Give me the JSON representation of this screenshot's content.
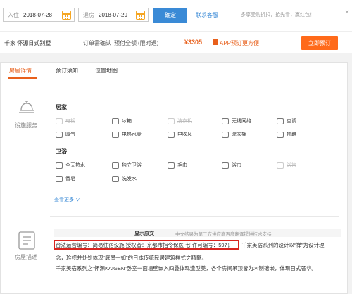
{
  "search": {
    "checkin_label": "入住",
    "checkin_value": "2018-07-28",
    "checkout_label": "退房",
    "checkout_value": "2018-07-29",
    "confirm_label": "确定",
    "contact_label": "联系客服",
    "promo_text": "多享受购折扣，抢先看，赢红包！",
    "close_label": "×"
  },
  "booking": {
    "hotel_name": "千家 怀源日式别墅",
    "order_confirm": "订单需确认",
    "prepay": "预付全额",
    "prepay_note": "(限时退)",
    "price": "¥3305",
    "app_promo": "APP预订更方便",
    "book_button": "立即预订"
  },
  "tabs": [
    {
      "label": "房屋详情",
      "active": true
    },
    {
      "label": "预订须知",
      "active": false
    },
    {
      "label": "位置地图",
      "active": false
    }
  ],
  "facilities": {
    "section_label": "设施服务",
    "home_title": "居家",
    "home_items": [
      {
        "label": "电视",
        "available": false
      },
      {
        "label": "冰箱",
        "available": true
      },
      {
        "label": "洗衣机",
        "available": false
      },
      {
        "label": "无线网络",
        "available": true
      },
      {
        "label": "空调",
        "available": true
      },
      {
        "label": "暖气",
        "available": true
      },
      {
        "label": "电热水壶",
        "available": true
      },
      {
        "label": "电吹风",
        "available": true
      },
      {
        "label": "晾衣架",
        "available": true
      },
      {
        "label": "拖鞋",
        "available": true
      }
    ],
    "bath_title": "卫浴",
    "bath_items": [
      {
        "label": "全天热水",
        "available": true
      },
      {
        "label": "独立卫浴",
        "available": true
      },
      {
        "label": "毛巾",
        "available": true
      },
      {
        "label": "浴巾",
        "available": true
      },
      {
        "label": "浴袍",
        "available": false
      },
      {
        "label": "香皂",
        "available": true
      },
      {
        "label": "洗发水",
        "available": true
      }
    ],
    "see_more": "查看更多 ∨"
  },
  "description": {
    "section_label": "房屋描述",
    "orig_title": "显示原文",
    "orig_note": "中文结果为第三方供应商百度翻译提供技术支持",
    "license_text": "合法运营编号：简易住宿设施 授权者：京都市指令保医 七 许可编号：597；",
    "line1_cont": "千家美宿系列的设计以“禅”为设计理",
    "line2": "念，珍视并处处体现“庭屋一如”的日本传统民居建筑样式之精髓。",
    "line3": "千家美宿系列之“怀源KAIGEN”卧室一面墙壁嵌入四叠体现造型美，各个房间吊顶皆为木制镶嵌，体现日式奢华。"
  },
  "colors": {
    "accent_orange": "#e8601c",
    "link_blue": "#3a8ad6",
    "highlight_red": "#d8241f"
  }
}
